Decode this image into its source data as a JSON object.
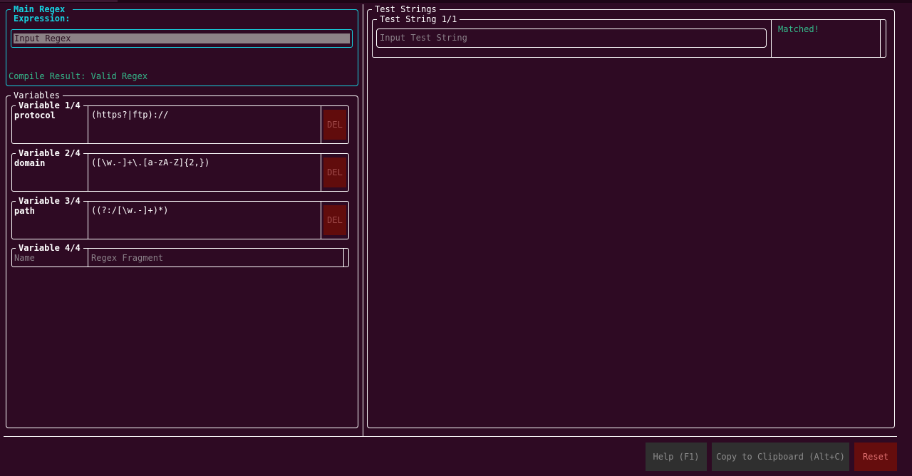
{
  "main_regex": {
    "title": "Main Regex\nExpression:",
    "input_placeholder": "Input Regex",
    "compile_result": "Compile Result: Valid Regex"
  },
  "variables": {
    "title": "Variables",
    "items": [
      {
        "legend": "Variable 1/4",
        "name": "protocol",
        "regex": "(https?|ftp)://",
        "delete_label": "DEL"
      },
      {
        "legend": "Variable 2/4",
        "name": "domain",
        "regex": "([\\w.-]+\\.[a-zA-Z]{2,})",
        "delete_label": "DEL"
      },
      {
        "legend": "Variable 3/4",
        "name": "path",
        "regex": "((?:/[\\w.-]+)*)",
        "delete_label": "DEL"
      }
    ],
    "new_item": {
      "legend": "Variable 4/4",
      "name_placeholder": "Name",
      "regex_placeholder": "Regex Fragment"
    }
  },
  "test_strings": {
    "title": "Test Strings",
    "items": [
      {
        "legend": "Test String 1/1",
        "input_placeholder": "Input Test String",
        "status": "Matched!"
      }
    ]
  },
  "footer": {
    "help_label": "Help (F1)",
    "copy_label": "Copy to Clipboard (Alt+C)",
    "reset_label": "Reset"
  },
  "colors": {
    "background": "#2e0a23",
    "accent": "#16d2e0",
    "success": "#34b88a",
    "danger": "#610c0c"
  }
}
